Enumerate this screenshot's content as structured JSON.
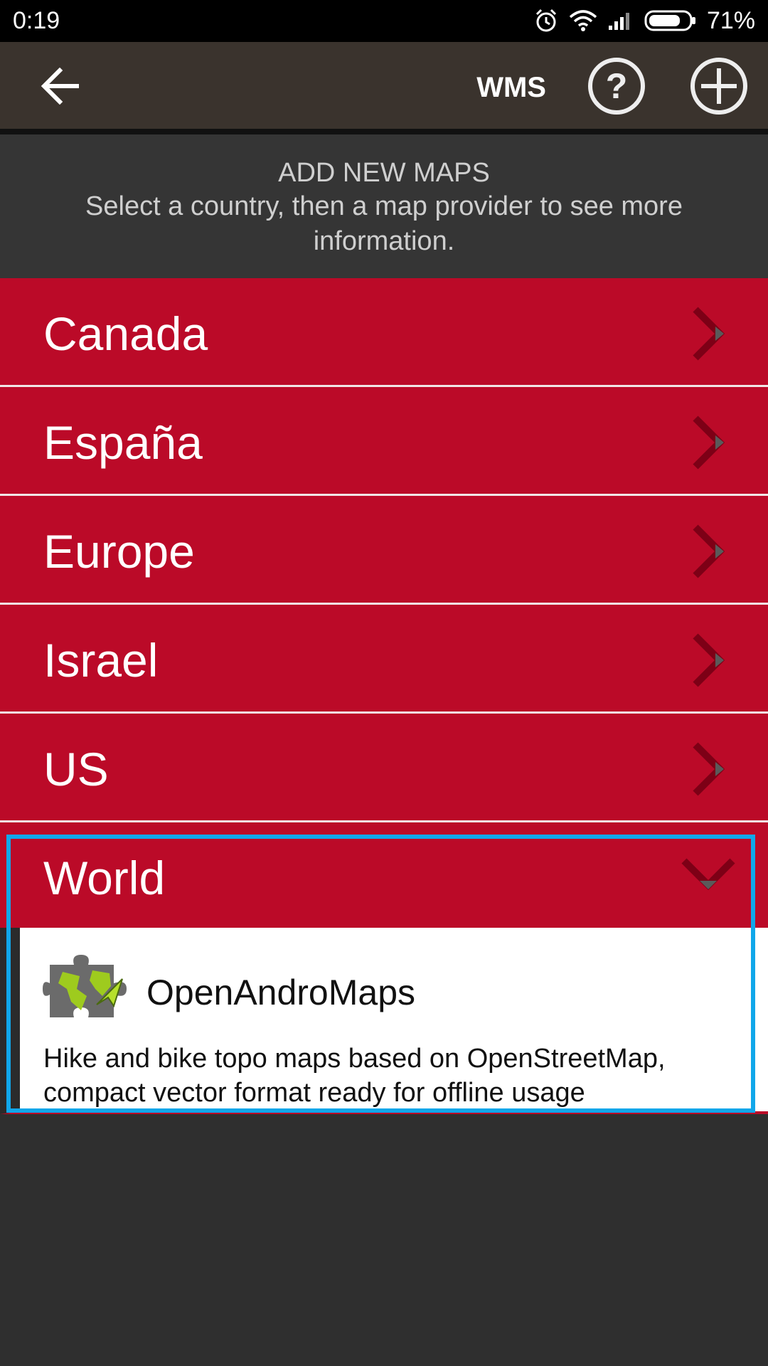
{
  "status_bar": {
    "time": "0:19",
    "battery_percent": "71%",
    "icons": [
      "alarm-icon",
      "wifi-icon",
      "signal-icon",
      "battery-icon"
    ]
  },
  "app_bar": {
    "title": "WMS",
    "icons": [
      "back-arrow-icon",
      "help-icon",
      "add-icon"
    ]
  },
  "header": {
    "title": "ADD NEW MAPS",
    "subtitle": "Select a country, then a map provider to see more information."
  },
  "countries": [
    {
      "label": "Canada"
    },
    {
      "label": "España"
    },
    {
      "label": "Europe"
    },
    {
      "label": "Israel"
    },
    {
      "label": "US"
    }
  ],
  "expanded": {
    "label": "World",
    "providers": [
      {
        "name": "OpenAndroMaps",
        "description": "Hike and bike topo maps based on OpenStreetMap, compact vector format ready for offline usage"
      }
    ]
  },
  "colors": {
    "row_red": "#bb0a28",
    "appbar": "#3a332d",
    "background": "#2f2f2f",
    "highlight": "#11a7ea",
    "chevron": "#7d0016"
  }
}
